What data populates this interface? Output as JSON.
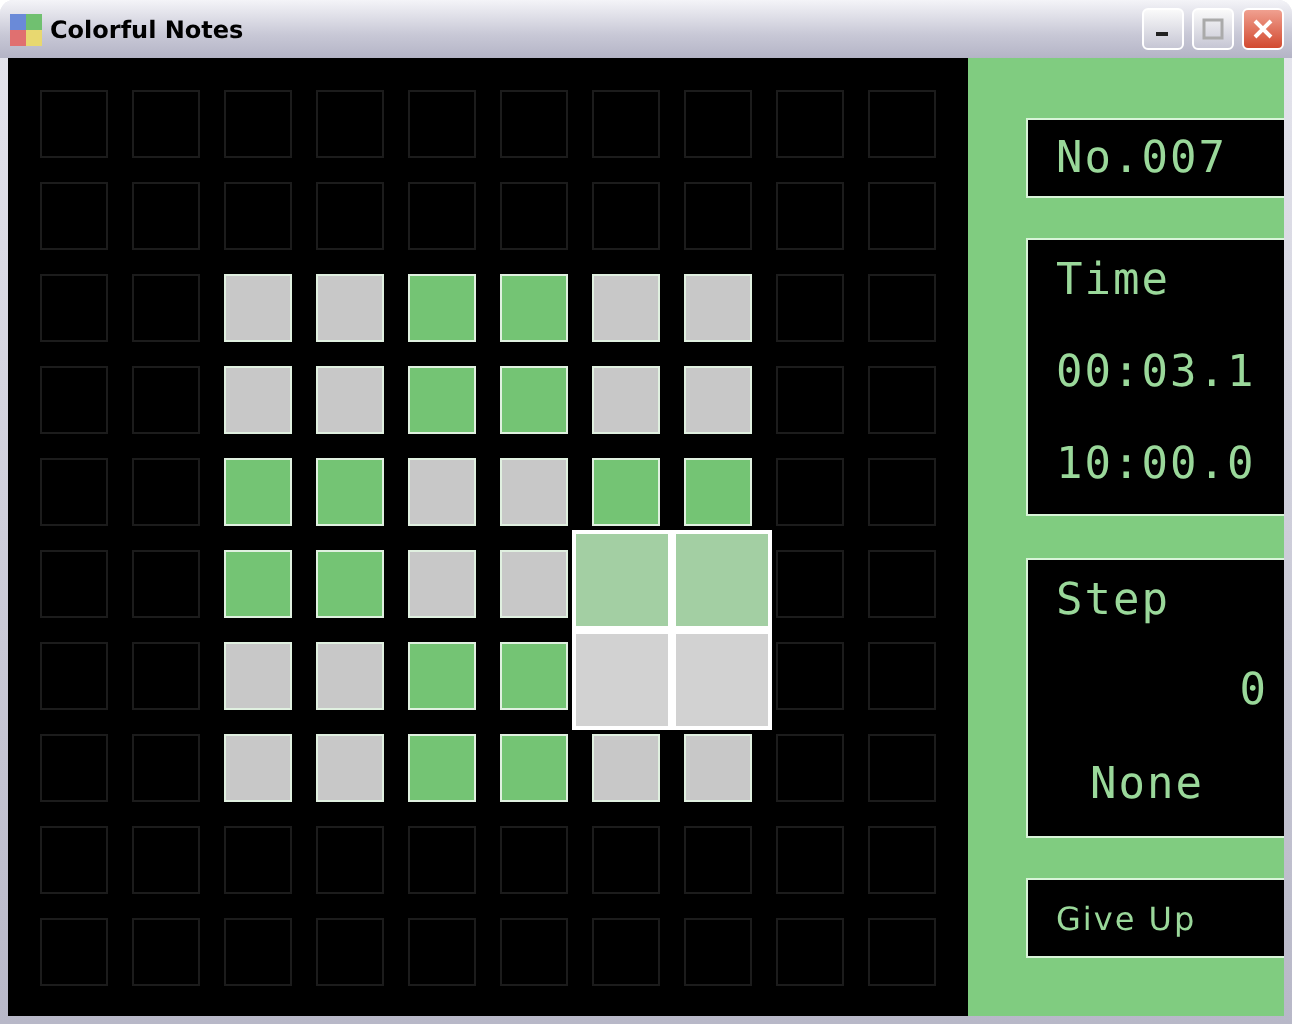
{
  "window": {
    "title": "Colorful Notes"
  },
  "board": {
    "rows": [
      {
        "cells": [
          {
            "kind": "empty",
            "selected": false
          },
          {
            "kind": "empty",
            "selected": false
          },
          {
            "kind": "empty",
            "selected": false
          },
          {
            "kind": "empty",
            "selected": false
          },
          {
            "kind": "empty",
            "selected": false
          },
          {
            "kind": "empty",
            "selected": false
          },
          {
            "kind": "empty",
            "selected": false
          },
          {
            "kind": "empty",
            "selected": false
          },
          {
            "kind": "empty",
            "selected": false
          },
          {
            "kind": "empty",
            "selected": false
          }
        ]
      },
      {
        "cells": [
          {
            "kind": "empty",
            "selected": false
          },
          {
            "kind": "empty",
            "selected": false
          },
          {
            "kind": "empty",
            "selected": false
          },
          {
            "kind": "empty",
            "selected": false
          },
          {
            "kind": "empty",
            "selected": false
          },
          {
            "kind": "empty",
            "selected": false
          },
          {
            "kind": "empty",
            "selected": false
          },
          {
            "kind": "empty",
            "selected": false
          },
          {
            "kind": "empty",
            "selected": false
          },
          {
            "kind": "empty",
            "selected": false
          }
        ]
      },
      {
        "cells": [
          {
            "kind": "empty",
            "selected": false
          },
          {
            "kind": "empty",
            "selected": false
          },
          {
            "kind": "gray",
            "selected": false
          },
          {
            "kind": "gray",
            "selected": false
          },
          {
            "kind": "green",
            "selected": false
          },
          {
            "kind": "green",
            "selected": false
          },
          {
            "kind": "gray",
            "selected": false
          },
          {
            "kind": "gray",
            "selected": false
          },
          {
            "kind": "empty",
            "selected": false
          },
          {
            "kind": "empty",
            "selected": false
          }
        ]
      },
      {
        "cells": [
          {
            "kind": "empty",
            "selected": false
          },
          {
            "kind": "empty",
            "selected": false
          },
          {
            "kind": "gray",
            "selected": false
          },
          {
            "kind": "gray",
            "selected": false
          },
          {
            "kind": "green",
            "selected": false
          },
          {
            "kind": "green",
            "selected": false
          },
          {
            "kind": "gray",
            "selected": false
          },
          {
            "kind": "gray",
            "selected": false
          },
          {
            "kind": "empty",
            "selected": false
          },
          {
            "kind": "empty",
            "selected": false
          }
        ]
      },
      {
        "cells": [
          {
            "kind": "empty",
            "selected": false
          },
          {
            "kind": "empty",
            "selected": false
          },
          {
            "kind": "green",
            "selected": false
          },
          {
            "kind": "green",
            "selected": false
          },
          {
            "kind": "gray",
            "selected": false
          },
          {
            "kind": "gray",
            "selected": false
          },
          {
            "kind": "green",
            "selected": false
          },
          {
            "kind": "green",
            "selected": false
          },
          {
            "kind": "empty",
            "selected": false
          },
          {
            "kind": "empty",
            "selected": false
          }
        ]
      },
      {
        "cells": [
          {
            "kind": "empty",
            "selected": false
          },
          {
            "kind": "empty",
            "selected": false
          },
          {
            "kind": "green",
            "selected": false
          },
          {
            "kind": "green",
            "selected": false
          },
          {
            "kind": "gray",
            "selected": false
          },
          {
            "kind": "gray",
            "selected": false
          },
          {
            "kind": "green",
            "selected": true
          },
          {
            "kind": "green",
            "selected": true
          },
          {
            "kind": "empty",
            "selected": false
          },
          {
            "kind": "empty",
            "selected": false
          }
        ]
      },
      {
        "cells": [
          {
            "kind": "empty",
            "selected": false
          },
          {
            "kind": "empty",
            "selected": false
          },
          {
            "kind": "gray",
            "selected": false
          },
          {
            "kind": "gray",
            "selected": false
          },
          {
            "kind": "green",
            "selected": false
          },
          {
            "kind": "green",
            "selected": false
          },
          {
            "kind": "gray",
            "selected": true
          },
          {
            "kind": "gray",
            "selected": true
          },
          {
            "kind": "empty",
            "selected": false
          },
          {
            "kind": "empty",
            "selected": false
          }
        ]
      },
      {
        "cells": [
          {
            "kind": "empty",
            "selected": false
          },
          {
            "kind": "empty",
            "selected": false
          },
          {
            "kind": "gray",
            "selected": false
          },
          {
            "kind": "gray",
            "selected": false
          },
          {
            "kind": "green",
            "selected": false
          },
          {
            "kind": "green",
            "selected": false
          },
          {
            "kind": "gray",
            "selected": false
          },
          {
            "kind": "gray",
            "selected": false
          },
          {
            "kind": "empty",
            "selected": false
          },
          {
            "kind": "empty",
            "selected": false
          }
        ]
      },
      {
        "cells": [
          {
            "kind": "empty",
            "selected": false
          },
          {
            "kind": "empty",
            "selected": false
          },
          {
            "kind": "empty",
            "selected": false
          },
          {
            "kind": "empty",
            "selected": false
          },
          {
            "kind": "empty",
            "selected": false
          },
          {
            "kind": "empty",
            "selected": false
          },
          {
            "kind": "empty",
            "selected": false
          },
          {
            "kind": "empty",
            "selected": false
          },
          {
            "kind": "empty",
            "selected": false
          },
          {
            "kind": "empty",
            "selected": false
          }
        ]
      },
      {
        "cells": [
          {
            "kind": "empty",
            "selected": false
          },
          {
            "kind": "empty",
            "selected": false
          },
          {
            "kind": "empty",
            "selected": false
          },
          {
            "kind": "empty",
            "selected": false
          },
          {
            "kind": "empty",
            "selected": false
          },
          {
            "kind": "empty",
            "selected": false
          },
          {
            "kind": "empty",
            "selected": false
          },
          {
            "kind": "empty",
            "selected": false
          },
          {
            "kind": "empty",
            "selected": false
          },
          {
            "kind": "empty",
            "selected": false
          }
        ]
      }
    ]
  },
  "panel": {
    "number": "No.007",
    "time": {
      "label": "Time",
      "elapsed": "00:03.1",
      "limit": "10:00.0"
    },
    "step": {
      "label": "Step",
      "count": "0",
      "last_move": "None"
    },
    "give_up_button": "Give Up"
  }
}
